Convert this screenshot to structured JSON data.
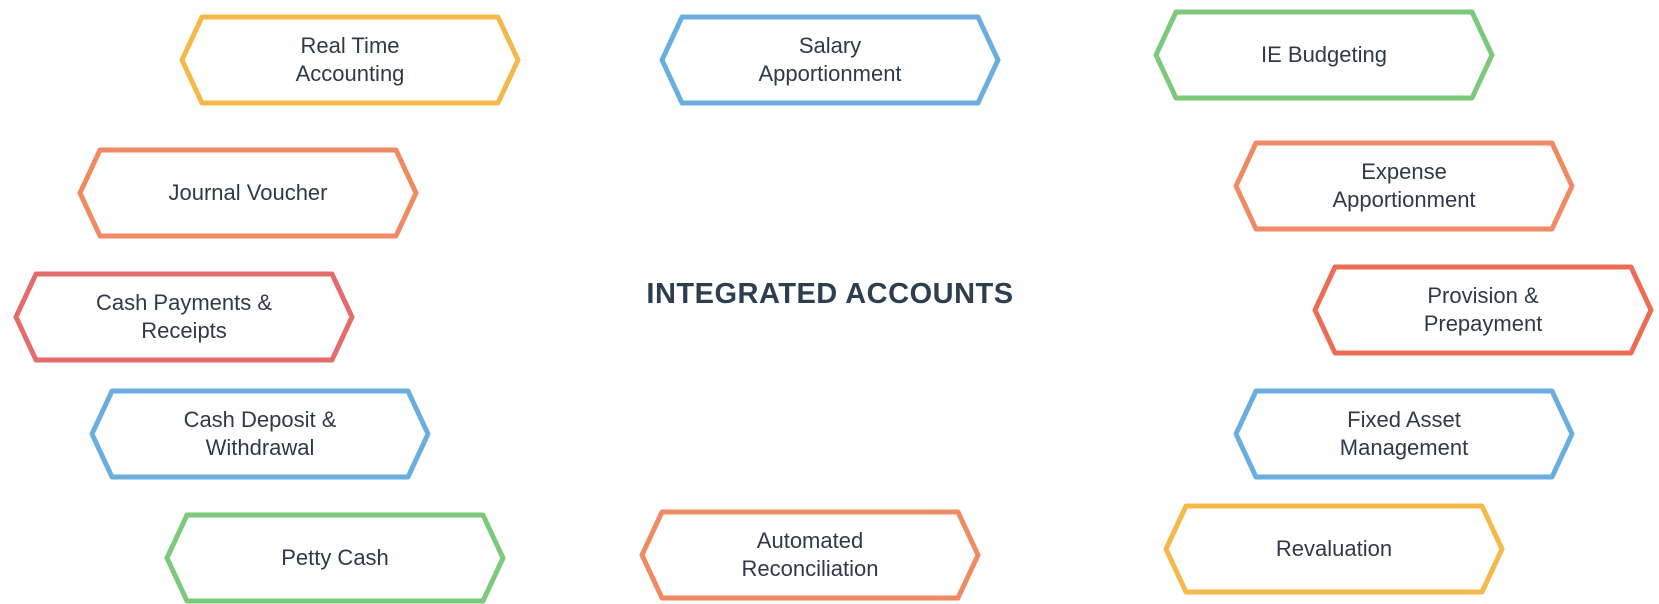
{
  "title": "INTEGRATED ACCOUNTS",
  "colors": {
    "yellow": "#f7b84b",
    "blue": "#6aaee0",
    "green": "#7dc97b",
    "orange": "#ef8a65",
    "red": "#e56b6b",
    "red_orange": "#ec6c56",
    "text": "#2e3a4a",
    "title": "#2c3e50"
  },
  "nodes": [
    {
      "label": "Real Time Accounting",
      "color": "#f7b84b"
    },
    {
      "label": "Salary Apportionment",
      "color": "#6aaee0"
    },
    {
      "label": "IE Budgeting",
      "color": "#7dc97b"
    },
    {
      "label": "Journal Voucher",
      "color": "#ef8a65"
    },
    {
      "label": "Expense Apportionment",
      "color": "#ef8a65"
    },
    {
      "label": "Cash Payments & Receipts",
      "color": "#e56b6b"
    },
    {
      "label": "Provision & Prepayment",
      "color": "#ec6c56"
    },
    {
      "label": "Cash Deposit & Withdrawal",
      "color": "#6aaee0"
    },
    {
      "label": "Fixed Asset Management",
      "color": "#6aaee0"
    },
    {
      "label": "Petty Cash",
      "color": "#7dc97b"
    },
    {
      "label": "Automated Reconciliation",
      "color": "#ef8a65"
    },
    {
      "label": "Revaluation",
      "color": "#f7b84b"
    }
  ]
}
